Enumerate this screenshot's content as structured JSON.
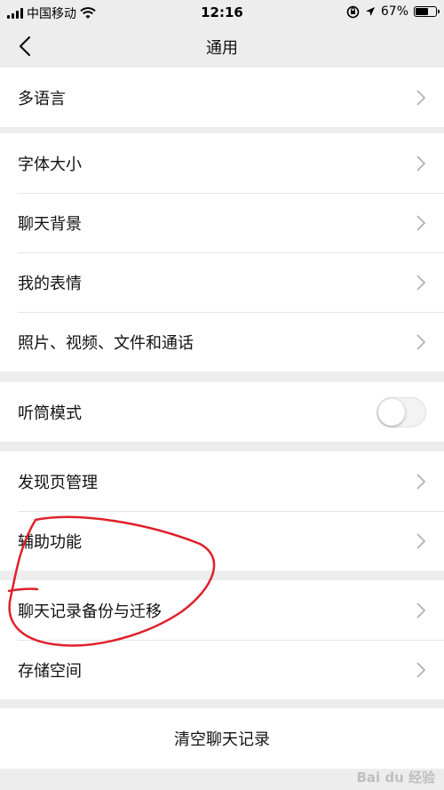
{
  "status_bar": {
    "carrier": "中国移动",
    "time": "12:16",
    "battery_percent": "67%",
    "battery_level": 0.67
  },
  "nav": {
    "title": "通用"
  },
  "groups": [
    {
      "items": [
        "多语言"
      ]
    },
    {
      "items": [
        "字体大小",
        "聊天背景",
        "我的表情",
        "照片、视频、文件和通话"
      ]
    },
    {
      "items": [
        "听筒模式"
      ],
      "toggle_on": false
    },
    {
      "items": [
        "发现页管理",
        "辅助功能"
      ]
    },
    {
      "items": [
        "聊天记录备份与迁移",
        "存储空间"
      ]
    }
  ],
  "clear_chat": "清空聊天记录",
  "watermark": "Bai du 经验",
  "colors": {
    "background": "#ededed",
    "annotation": "#e0202a"
  }
}
